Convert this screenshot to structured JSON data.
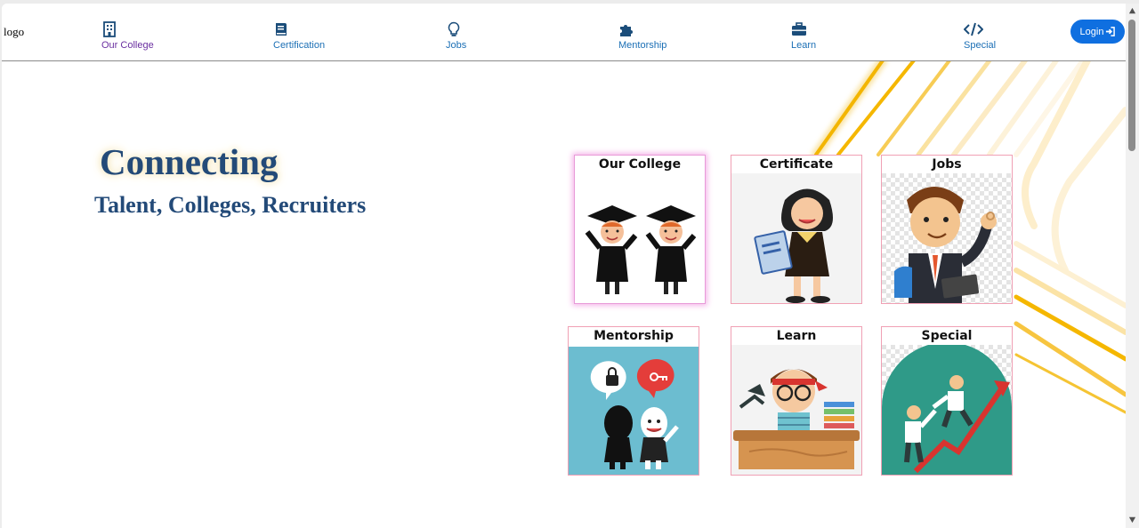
{
  "header": {
    "logo_text": "logo",
    "nav": [
      {
        "label": "Our College",
        "icon": "building-icon"
      },
      {
        "label": "Certification",
        "icon": "book-icon"
      },
      {
        "label": "Jobs",
        "icon": "lightbulb-icon"
      },
      {
        "label": "Mentorship",
        "icon": "puzzle-icon"
      },
      {
        "label": "Learn",
        "icon": "briefcase-icon"
      },
      {
        "label": "Special",
        "icon": "code-icon"
      }
    ],
    "login_label": "Login"
  },
  "hero": {
    "title": "Connecting",
    "subtitle": "Talent, Colleges, Recruiters"
  },
  "cards": [
    {
      "title": "Our College"
    },
    {
      "title": "Certificate"
    },
    {
      "title": "Jobs"
    },
    {
      "title": "Mentorship"
    },
    {
      "title": "Learn"
    },
    {
      "title": "Special"
    }
  ],
  "colors": {
    "nav_link": "#1b6fb5",
    "nav_visited": "#6a2fa0",
    "accent": "#0f6fe0",
    "heading": "#234a78",
    "stripe": "#f3b500",
    "card_border": "#f0a0b4"
  }
}
